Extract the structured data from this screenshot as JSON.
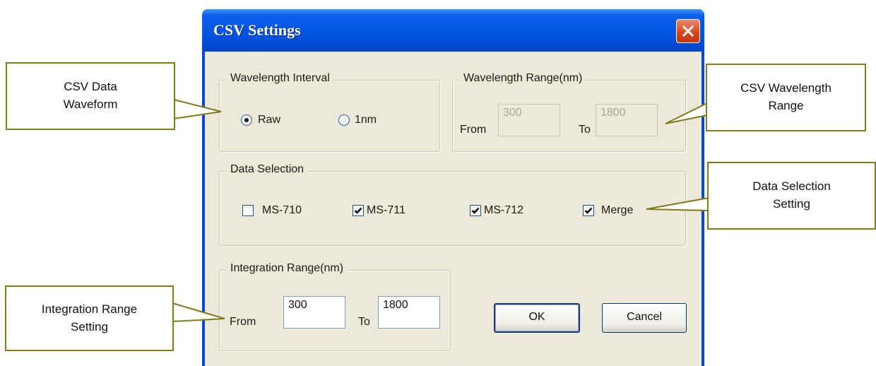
{
  "dialog": {
    "title": "CSV Settings",
    "wavelength_interval": {
      "legend": "Wavelength Interval",
      "options": [
        {
          "label": "Raw",
          "selected": true
        },
        {
          "label": "1nm",
          "selected": false
        }
      ]
    },
    "wavelength_range": {
      "legend": "Wavelength Range(nm)",
      "from_label": "From",
      "from_value": "300",
      "to_label": "To",
      "to_value": "1800",
      "enabled": false
    },
    "data_selection": {
      "legend": "Data Selection",
      "items": [
        {
          "label": "MS-710",
          "checked": false
        },
        {
          "label": "MS-711",
          "checked": true
        },
        {
          "label": "MS-712",
          "checked": true
        },
        {
          "label": "Merge",
          "checked": true
        }
      ]
    },
    "integration_range": {
      "legend": "Integration Range(nm)",
      "from_label": "From",
      "from_value": "300",
      "to_label": "To",
      "to_value": "1800"
    },
    "buttons": {
      "ok": "OK",
      "cancel": "Cancel"
    }
  },
  "callouts": {
    "csv_data_waveform": [
      "CSV Data",
      "Waveform"
    ],
    "csv_wavelength_range": [
      "CSV Wavelength",
      "Range"
    ],
    "data_selection_setting": [
      "Data Selection",
      "Setting"
    ],
    "integration_range_setting": [
      "Integration Range",
      "Setting"
    ]
  },
  "colors": {
    "titlebar": "#0054e3",
    "dialog_face": "#ece9d8",
    "callout_border": "#807b17",
    "close_button": "#d8431a"
  }
}
